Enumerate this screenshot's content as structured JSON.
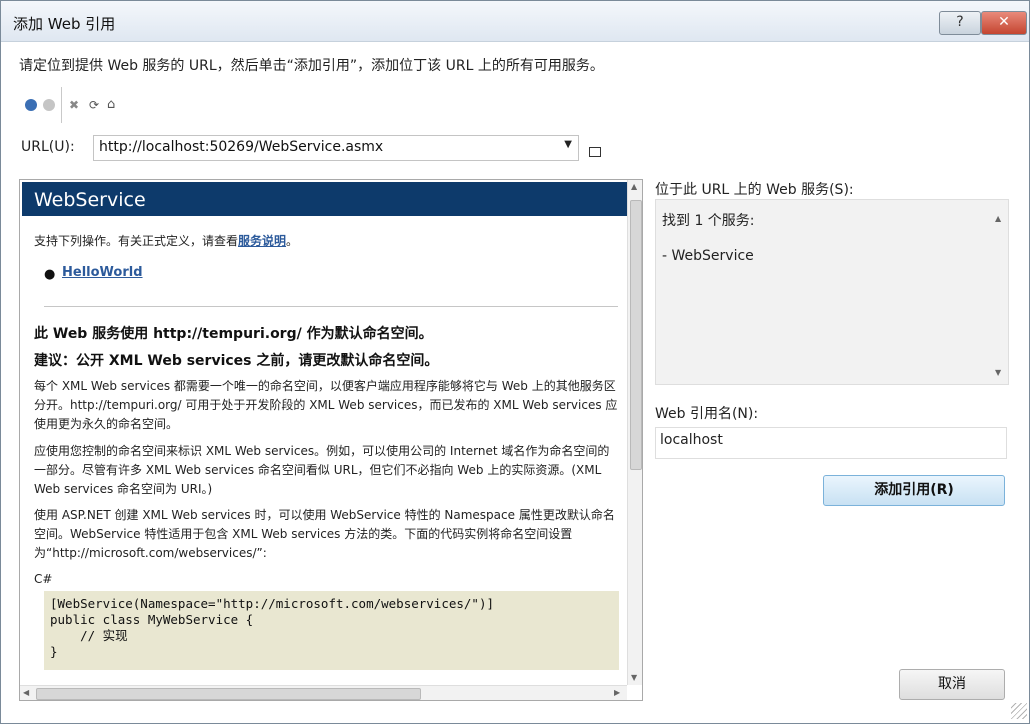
{
  "window": {
    "title": "添加 Web 引用",
    "help_label": "?",
    "close_label": "✕"
  },
  "instruction": "请定位到提供 Web 服务的 URL，然后单击“添加引用”，添加位丁该 URL 上的所有可用服务。",
  "toolbar": {
    "back_icon": "back-icon",
    "forward_icon": "forward-icon",
    "stop_icon": "stop-icon",
    "refresh_icon": "refresh-icon",
    "home_icon": "home-icon"
  },
  "url": {
    "label": "URL(U):",
    "value": "http://localhost:50269/WebService.asmx"
  },
  "page": {
    "header_title": "WebService",
    "support_text": "支持下列操作。有关正式定义，请查看",
    "service_desc_link": "服务说明",
    "support_suffix": "。",
    "operations": [
      "HelloWorld"
    ],
    "namespace_notice": "此 Web 服务使用 http://tempuri.org/ 作为默认命名空间。",
    "recommendation": "建议：公开 XML Web services 之前，请更改默认命名空间。",
    "para1": "每个 XML Web services 都需要一个唯一的命名空间，以便客户端应用程序能够将它与 Web 上的其他服务区分开。http://tempuri.org/ 可用于处于开发阶段的 XML Web services，而已发布的 XML Web services 应使用更为永久的命名空间。",
    "para2": "应使用您控制的命名空间来标识 XML Web services。例如，可以使用公司的 Internet 域名作为命名空间的一部分。尽管有许多 XML Web services 命名空间看似 URL，但它们不必指向 Web 上的实际资源。(XML Web services 命名空间为 URI。)",
    "para3": "使用 ASP.NET 创建 XML Web services 时，可以使用 WebService 特性的 Namespace 属性更改默认命名空间。WebService 特性适用于包含 XML Web services 方法的类。下面的代码实例将命名空间设置为“http://microsoft.com/webservices/”:",
    "code_lang": "C#",
    "code": "[WebService(Namespace=\"http://microsoft.com/webservices/\")]\npublic class MyWebService {\n    // 实现\n}"
  },
  "services": {
    "label": "位于此 URL 上的 Web 服务(S):",
    "found": "找到 1 个服务:",
    "items": [
      "- WebService"
    ]
  },
  "web_ref": {
    "label": "Web 引用名(N):",
    "value": "localhost"
  },
  "buttons": {
    "add": "添加引用(R)",
    "cancel": "取消"
  }
}
